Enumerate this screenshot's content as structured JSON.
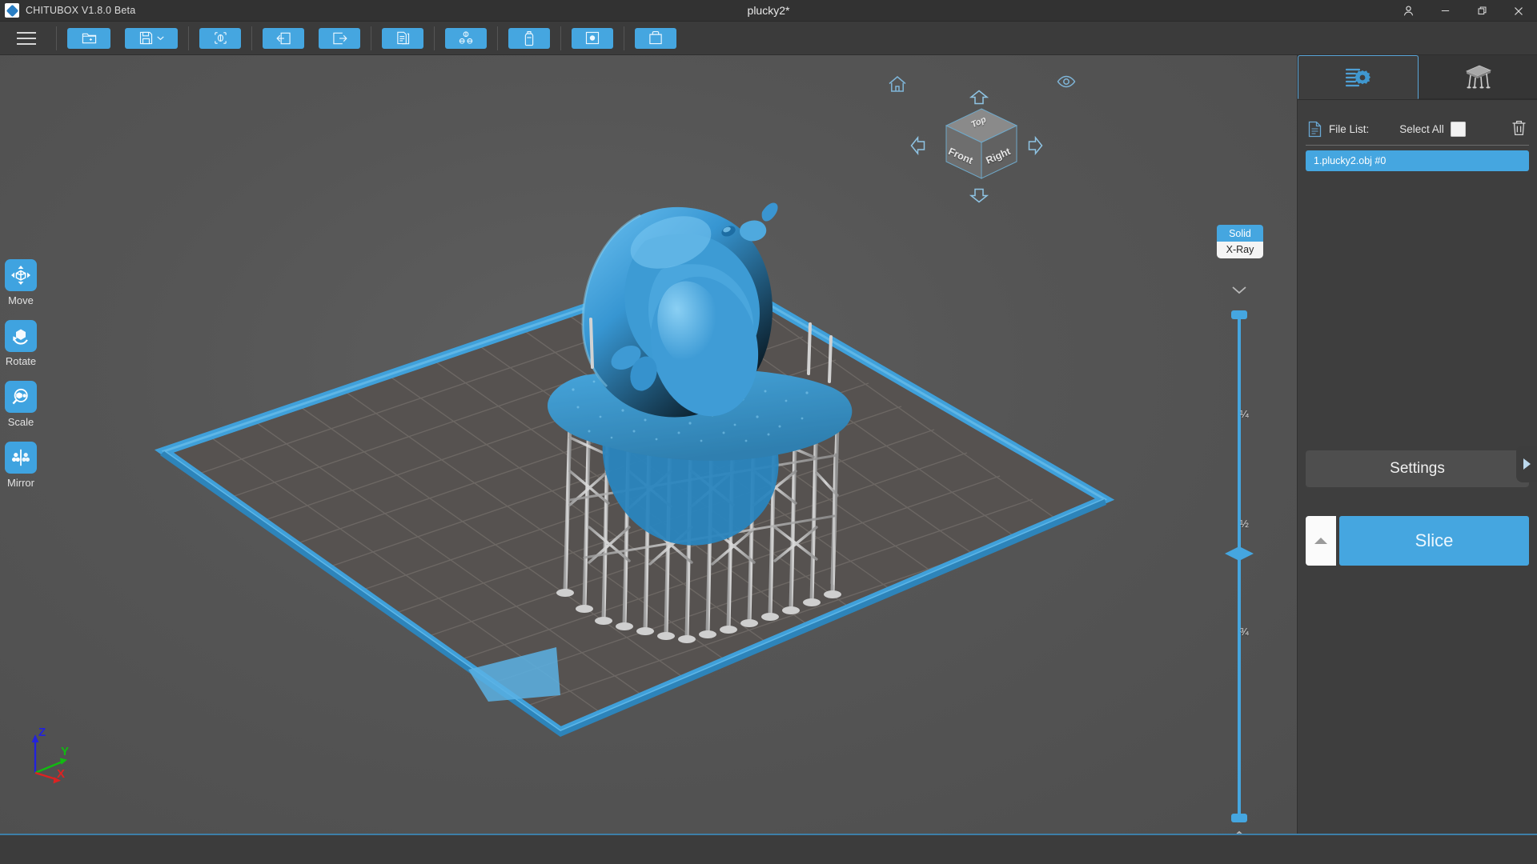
{
  "window": {
    "app_name": "CHITUBOX V1.8.0 Beta",
    "document_title": "plucky2*",
    "logo_icon": "chitubox-diamond-icon",
    "controls": [
      {
        "name": "account-icon",
        "label": ""
      },
      {
        "name": "minimize-icon",
        "label": ""
      },
      {
        "name": "restore-icon",
        "label": ""
      },
      {
        "name": "close-icon",
        "label": ""
      }
    ]
  },
  "toolbar": {
    "menu_icon": "hamburger-menu-icon",
    "buttons": [
      {
        "name": "open-file-button",
        "icon": "folder-open-icon",
        "tooltip": "Open File"
      },
      {
        "name": "save-file-button",
        "icon": "floppy-disk-icon",
        "tooltip": "Save File",
        "has_dropdown": true
      },
      {
        "name": "add-plate-button",
        "icon": "plate-object-icon",
        "tooltip": "Add to Plate"
      },
      {
        "name": "undo-button",
        "icon": "arrow-left-box-icon",
        "tooltip": "Undo"
      },
      {
        "name": "redo-button",
        "icon": "arrow-right-box-icon",
        "tooltip": "Redo"
      },
      {
        "name": "copy-button",
        "icon": "duplicate-pages-icon",
        "tooltip": "Duplicate"
      },
      {
        "name": "arrange-button",
        "icon": "auto-arrange-icon",
        "tooltip": "Auto Arrange"
      },
      {
        "name": "hollow-button",
        "icon": "hollow-bottle-icon",
        "tooltip": "Hollow"
      },
      {
        "name": "drill-hole-button",
        "icon": "drill-hole-icon",
        "tooltip": "Drill Hole"
      },
      {
        "name": "cut-button",
        "icon": "cut-box-icon",
        "tooltip": "Cut"
      }
    ]
  },
  "left_rail": {
    "tools": [
      {
        "name": "move-tool",
        "label": "Move",
        "icon": "move-arrows-cube-icon"
      },
      {
        "name": "rotate-tool",
        "label": "Rotate",
        "icon": "rotate-cube-icon"
      },
      {
        "name": "scale-tool",
        "label": "Scale",
        "icon": "scale-magnifier-cube-icon"
      },
      {
        "name": "mirror-tool",
        "label": "Mirror",
        "icon": "mirror-flip-icon"
      }
    ]
  },
  "viewport": {
    "axis_gizmo": {
      "name": "axis-orientation-gizmo",
      "axes": [
        {
          "label": "Z",
          "color": "#2222dd"
        },
        {
          "label": "Y",
          "color": "#11bb11"
        },
        {
          "label": "X",
          "color": "#dd2222"
        }
      ]
    },
    "view_cube": {
      "name": "view-orientation-cube",
      "faces": {
        "top": "Top",
        "front": "Front",
        "right": "Right"
      },
      "home_icon": "home-icon",
      "eye_icon": "eye-visibility-icon",
      "arrows": [
        "rotate-up-arrow",
        "rotate-down-arrow",
        "rotate-left-arrow",
        "rotate-right-arrow"
      ]
    },
    "render_mode": {
      "name": "render-mode-toggle",
      "solid_label": "Solid",
      "xray_label": "X-Ray",
      "selected": "Solid",
      "active_color": "#45a6e0"
    },
    "slice_slider": {
      "name": "slice-preview-slider",
      "ticks": [
        "¼",
        "½",
        "¾"
      ],
      "top_chevron": "chevron-down-icon",
      "bottom_chevron": "chevron-up-icon",
      "track_color": "#45a6e0"
    },
    "build_plate": {
      "name": "build-plate",
      "frame_color": "#3fa0da",
      "surface_color": "#565656",
      "grid_color": "#6e6a66"
    },
    "model": {
      "name": "model-plucky2",
      "color": "#2f8fcb",
      "support_color": "#c7c7c7"
    }
  },
  "right_panel": {
    "tabs": [
      {
        "name": "tab-settings",
        "icon": "settings-sliders-gear-icon",
        "active": true
      },
      {
        "name": "tab-supports",
        "icon": "support-pillars-icon",
        "active": false
      }
    ],
    "file_list": {
      "icon": "document-icon",
      "title": "File List:",
      "select_all_label": "Select All",
      "delete_icon": "trash-can-icon",
      "items": [
        {
          "name": "file-list-item",
          "label": "1.plucky2.obj #0",
          "selected": true
        }
      ]
    },
    "settings_button_label": "Settings",
    "slice_button_label": "Slice",
    "slice_caret_icon": "caret-up-icon",
    "collapse_handle_icon": "caret-right-icon"
  }
}
